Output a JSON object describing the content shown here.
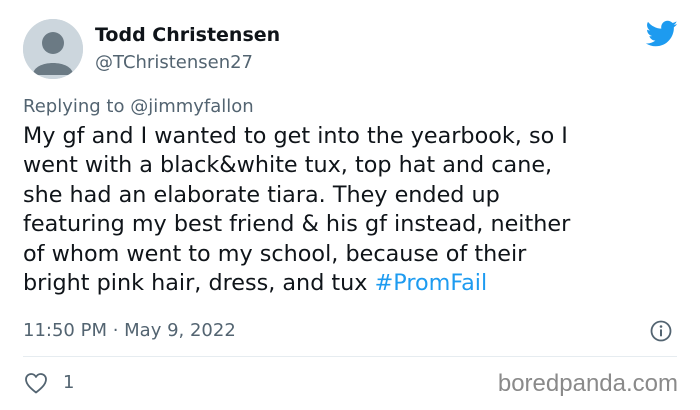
{
  "author": {
    "name": "Todd Christensen",
    "handle": "@TChristensen27"
  },
  "reply": {
    "prefix": "Replying to ",
    "mention": "@jimmyfallon"
  },
  "tweet": {
    "lines": [
      "My gf and I wanted to get into the yearbook, so I",
      "went with a black&white tux, top hat and cane,",
      "she had an elaborate tiara. They ended up",
      "featuring my best friend & his gf instead, neither",
      "of whom went to my school, because of their",
      "bright pink hair, dress, and tux "
    ],
    "hashtag": "#PromFail"
  },
  "meta": {
    "time": "11:50 PM · May 9, 2022"
  },
  "actions": {
    "likes": "1"
  },
  "watermark": "boredpanda.com",
  "icons": {
    "logo": "twitter-bird-icon",
    "info": "info-icon",
    "like": "heart-icon"
  },
  "colors": {
    "accent": "#1d9bf0",
    "secondary_text": "#536471",
    "primary_text": "#0f1419"
  }
}
